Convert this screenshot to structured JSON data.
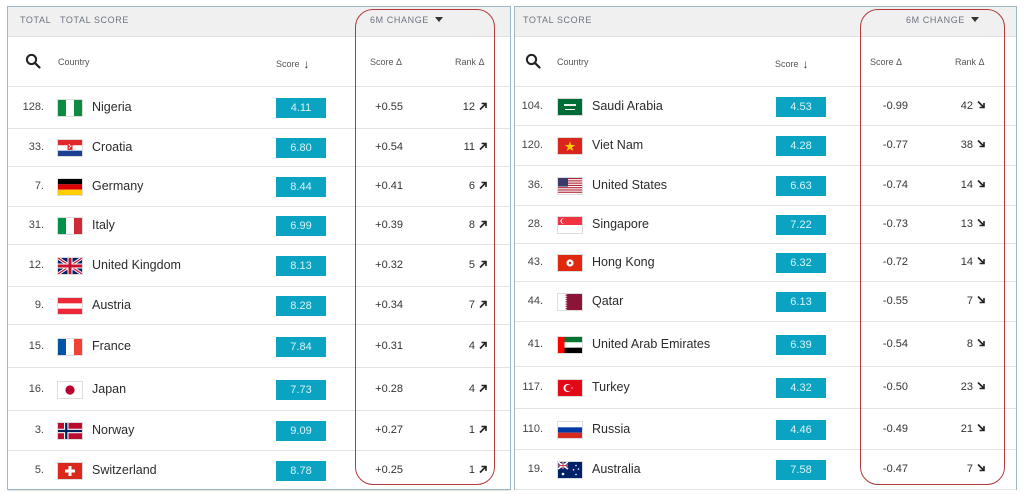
{
  "left_table": {
    "header": {
      "total": "TOTAL",
      "total_score": "TOTAL SCORE",
      "change": "6M CHANGE"
    },
    "columns": {
      "country": "Country",
      "score": "Score",
      "score_delta": "Score Δ",
      "rank_delta": "Rank Δ"
    },
    "rows": [
      {
        "rank": "128.",
        "country": "Nigeria",
        "flag": "flag-nigeria",
        "score": "4.11",
        "delta": "+0.55",
        "rank_change": "12",
        "direction": "up"
      },
      {
        "rank": "33.",
        "country": "Croatia",
        "flag": "flag-croatia",
        "score": "6.80",
        "delta": "+0.54",
        "rank_change": "11",
        "direction": "up"
      },
      {
        "rank": "7.",
        "country": "Germany",
        "flag": "flag-germany",
        "score": "8.44",
        "delta": "+0.41",
        "rank_change": "6",
        "direction": "up"
      },
      {
        "rank": "31.",
        "country": "Italy",
        "flag": "flag-italy",
        "score": "6.99",
        "delta": "+0.39",
        "rank_change": "8",
        "direction": "up"
      },
      {
        "rank": "12.",
        "country": "United Kingdom",
        "flag": "flag-uk",
        "score": "8.13",
        "delta": "+0.32",
        "rank_change": "5",
        "direction": "up"
      },
      {
        "rank": "9.",
        "country": "Austria",
        "flag": "flag-austria",
        "score": "8.28",
        "delta": "+0.34",
        "rank_change": "7",
        "direction": "up"
      },
      {
        "rank": "15.",
        "country": "France",
        "flag": "flag-france",
        "score": "7.84",
        "delta": "+0.31",
        "rank_change": "4",
        "direction": "up"
      },
      {
        "rank": "16.",
        "country": "Japan",
        "flag": "flag-japan",
        "score": "7.73",
        "delta": "+0.28",
        "rank_change": "4",
        "direction": "up"
      },
      {
        "rank": "3.",
        "country": "Norway",
        "flag": "flag-norway",
        "score": "9.09",
        "delta": "+0.27",
        "rank_change": "1",
        "direction": "up"
      },
      {
        "rank": "5.",
        "country": "Switzerland",
        "flag": "flag-switzerland",
        "score": "8.78",
        "delta": "+0.25",
        "rank_change": "1",
        "direction": "up"
      }
    ]
  },
  "right_table": {
    "header": {
      "total_score": "TOTAL SCORE",
      "change": "6M CHANGE"
    },
    "columns": {
      "country": "Country",
      "score": "Score",
      "score_delta": "Score Δ",
      "rank_delta": "Rank Δ"
    },
    "rows": [
      {
        "rank": "104.",
        "country": "Saudi Arabia",
        "flag": "flag-saudi-arabia",
        "score": "4.53",
        "delta": "-0.99",
        "rank_change": "42",
        "direction": "down"
      },
      {
        "rank": "120.",
        "country": "Viet Nam",
        "flag": "flag-viet-nam",
        "score": "4.28",
        "delta": "-0.77",
        "rank_change": "38",
        "direction": "down"
      },
      {
        "rank": "36.",
        "country": "United States",
        "flag": "flag-united-states",
        "score": "6.63",
        "delta": "-0.74",
        "rank_change": "14",
        "direction": "down"
      },
      {
        "rank": "28.",
        "country": "Singapore",
        "flag": "flag-singapore",
        "score": "7.22",
        "delta": "-0.73",
        "rank_change": "13",
        "direction": "down"
      },
      {
        "rank": "43.",
        "country": "Hong Kong",
        "flag": "flag-hong-kong",
        "score": "6.32",
        "delta": "-0.72",
        "rank_change": "14",
        "direction": "down"
      },
      {
        "rank": "44.",
        "country": "Qatar",
        "flag": "flag-qatar",
        "score": "6.13",
        "delta": "-0.55",
        "rank_change": "7",
        "direction": "down"
      },
      {
        "rank": "41.",
        "country": "United Arab Emirates",
        "flag": "flag-uae",
        "score": "6.39",
        "delta": "-0.54",
        "rank_change": "8",
        "direction": "down"
      },
      {
        "rank": "117.",
        "country": "Turkey",
        "flag": "flag-turkey",
        "score": "4.32",
        "delta": "-0.50",
        "rank_change": "23",
        "direction": "down"
      },
      {
        "rank": "110.",
        "country": "Russia",
        "flag": "flag-russia",
        "score": "4.46",
        "delta": "-0.49",
        "rank_change": "21",
        "direction": "down"
      },
      {
        "rank": "19.",
        "country": "Australia",
        "flag": "flag-australia",
        "score": "7.58",
        "delta": "-0.47",
        "rank_change": "7",
        "direction": "down"
      }
    ]
  },
  "colors": {
    "score_badge": "#0aa3c2",
    "highlight": "#b23a3a",
    "panel_border": "#9fb8c6"
  }
}
